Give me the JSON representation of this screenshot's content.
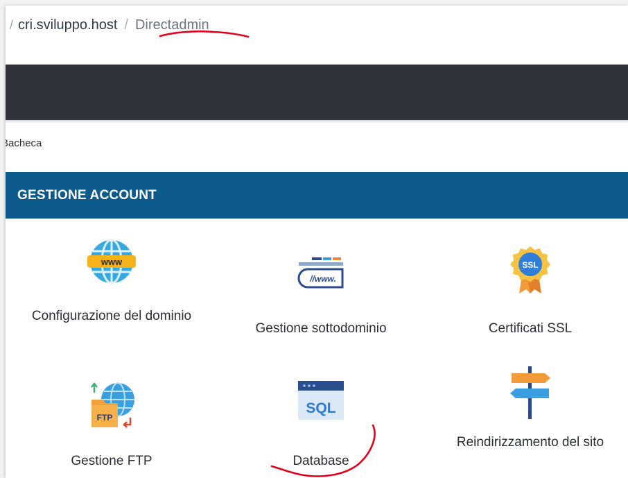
{
  "breadcrumb": {
    "lead_separator": "/",
    "host": "cri.sviluppo.host",
    "separator": "/",
    "current": "Directadmin"
  },
  "subnav": {
    "label": "Bacheca"
  },
  "section": {
    "title": "GESTIONE ACCOUNT"
  },
  "items": [
    {
      "label": "Configurazione del dominio",
      "icon": "globe-www-icon"
    },
    {
      "label": "Gestione sottodominio",
      "icon": "address-bar-www-icon"
    },
    {
      "label": "Certificati SSL",
      "icon": "ssl-badge-icon"
    },
    {
      "label": "Gestione FTP",
      "icon": "ftp-folder-globe-icon"
    },
    {
      "label": "Database",
      "icon": "sql-window-icon"
    },
    {
      "label": "Reindirizzamento del sito",
      "icon": "signpost-icon"
    }
  ],
  "colors": {
    "topbar": "#30323a",
    "section_bar": "#0d5a8c",
    "annotation_red": "#e3001b"
  }
}
